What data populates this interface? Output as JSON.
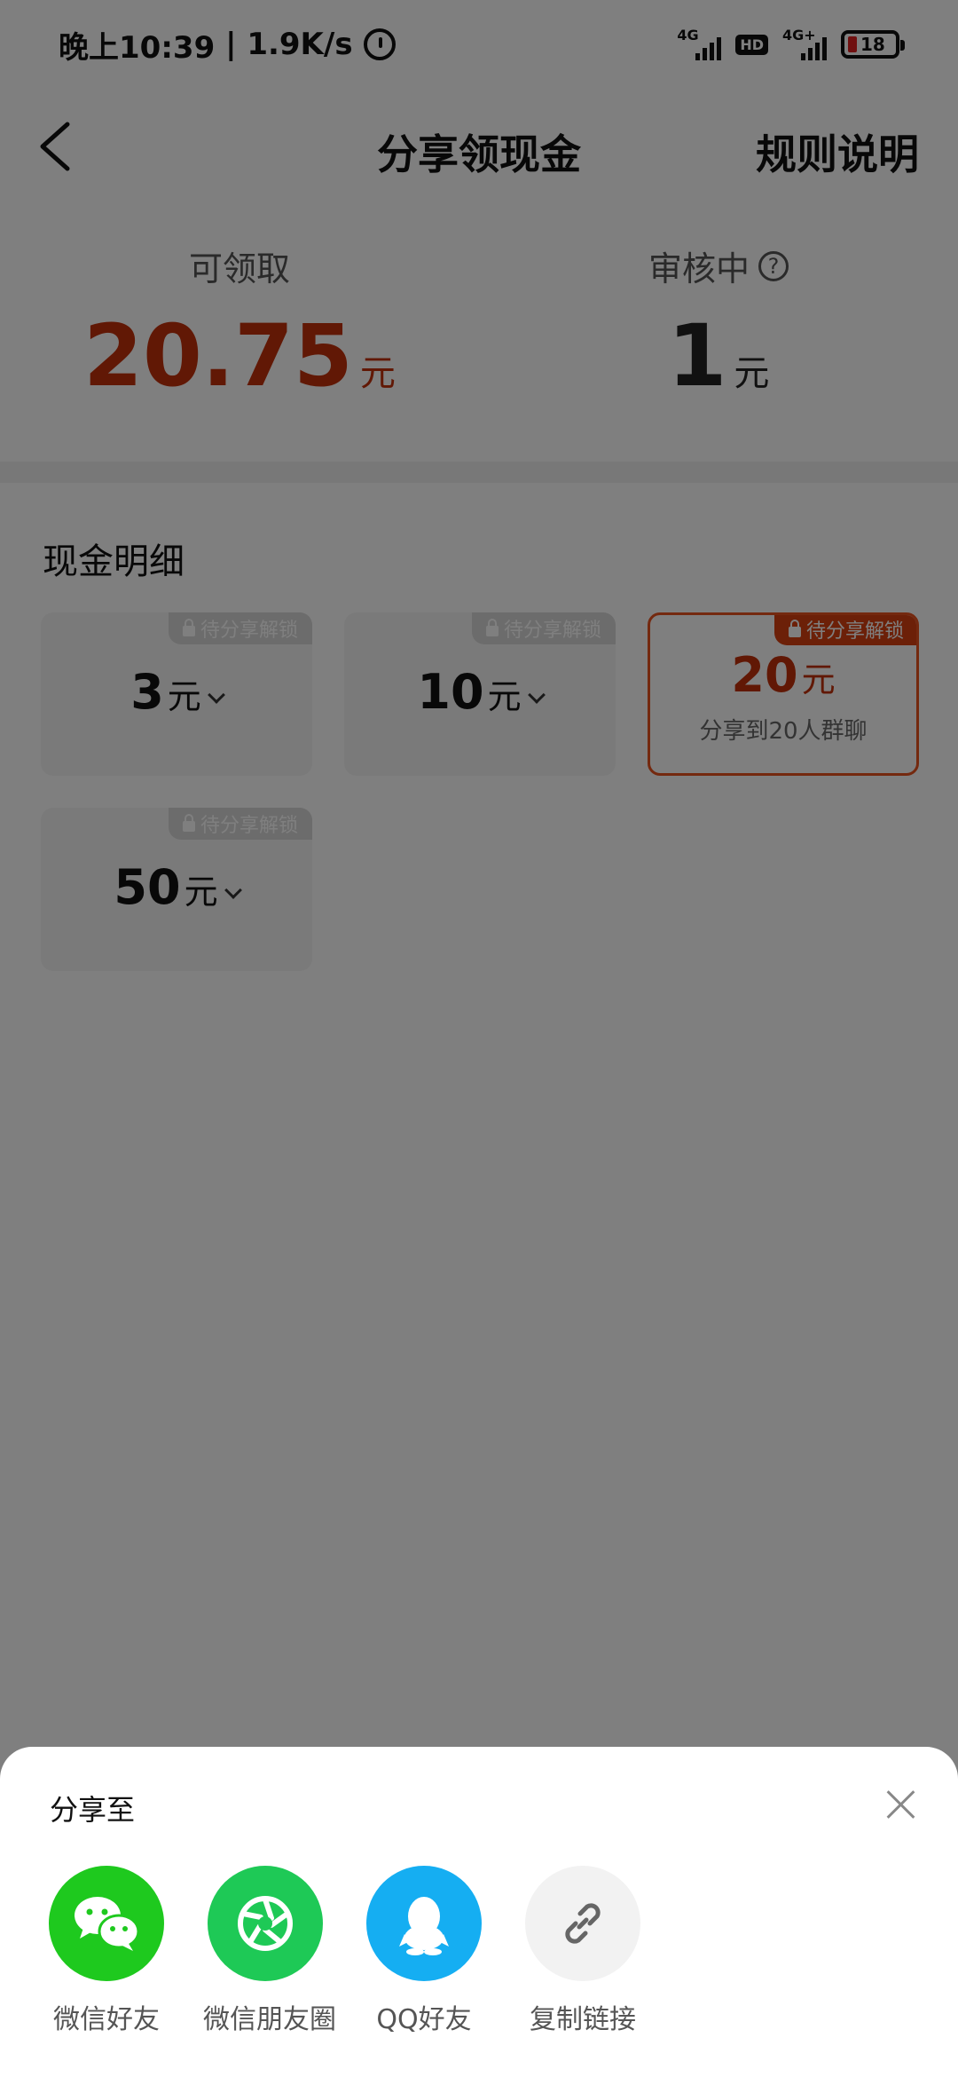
{
  "status_bar": {
    "time": "晚上10:39",
    "speed": "1.9K/s",
    "network1": "4G",
    "hd": "HD",
    "network2": "4G+",
    "battery": "18"
  },
  "nav": {
    "title": "分享领现金",
    "rules_label": "规则说明"
  },
  "balance": {
    "available_label": "可领取",
    "available_value": "20.75",
    "available_unit": "元",
    "reviewing_label": "审核中",
    "reviewing_value": "1",
    "reviewing_unit": "元"
  },
  "cash_detail": {
    "title": "现金明细",
    "cards": [
      {
        "tag": "待分享解锁",
        "amount": "3",
        "unit": "元",
        "selected": false
      },
      {
        "tag": "待分享解锁",
        "amount": "10",
        "unit": "元",
        "selected": false
      },
      {
        "tag": "待分享解锁",
        "amount": "20",
        "unit": "元",
        "subtitle": "分享到20人群聊",
        "selected": true
      },
      {
        "tag": "待分享解锁",
        "amount": "50",
        "unit": "元",
        "selected": false
      }
    ]
  },
  "share_sheet": {
    "title": "分享至",
    "items": [
      {
        "label": "微信好友",
        "icon": "wechat-icon",
        "color": "#1ec91e"
      },
      {
        "label": "微信朋友圈",
        "icon": "moments-icon",
        "color": "#1ec956"
      },
      {
        "label": "QQ好友",
        "icon": "qq-icon",
        "color": "#15aef2"
      },
      {
        "label": "复制链接",
        "icon": "link-icon",
        "color": "#f2f2f2"
      }
    ]
  },
  "colors": {
    "accent": "#c2300b",
    "tag_active": "#d94011",
    "selected_border": "#e8521e"
  }
}
